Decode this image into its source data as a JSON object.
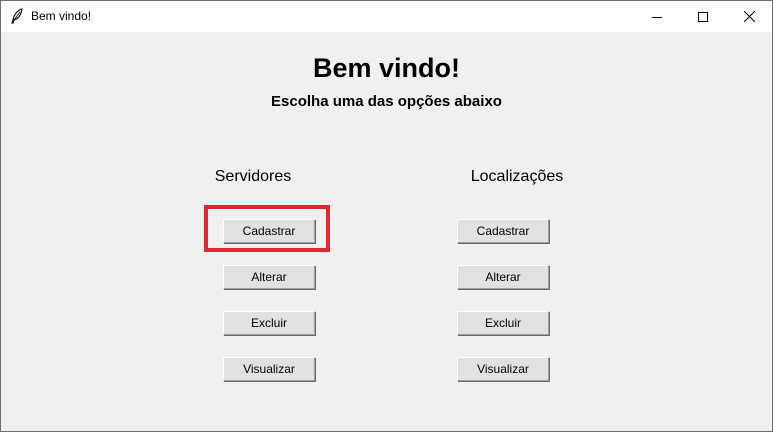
{
  "window": {
    "title": "Bem vindo!",
    "app_icon": "feather-icon",
    "controls": {
      "minimize_icon": "minimize-icon",
      "maximize_icon": "maximize-icon",
      "close_icon": "close-icon"
    }
  },
  "main": {
    "heading": "Bem vindo!",
    "subheading": "Escolha uma das opções abaixo"
  },
  "servidores": {
    "label": "Servidores",
    "buttons": {
      "cadastrar": "Cadastrar",
      "alterar": "Alterar",
      "excluir": "Excluir",
      "visualizar": "Visualizar"
    }
  },
  "localizacoes": {
    "label": "Localizações",
    "buttons": {
      "cadastrar": "Cadastrar",
      "alterar": "Alterar",
      "excluir": "Excluir",
      "visualizar": "Visualizar"
    }
  },
  "colors": {
    "highlight": "#e2252f",
    "window_bg": "#f0f0f0",
    "button_bg": "#e1e1e1"
  }
}
